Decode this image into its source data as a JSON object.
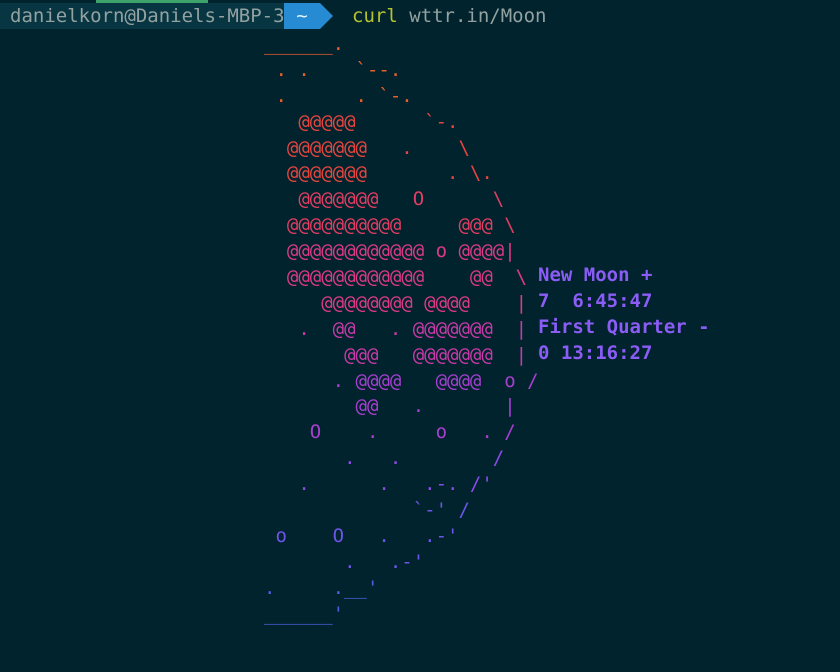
{
  "prompt": {
    "host": "danielkorn@Daniels-MBP-3",
    "dir": "~",
    "command": "curl",
    "argument": "wttr.in/Moon"
  },
  "moon_art": [
    "______.",
    " . .    `--.",
    " .      . `-.",
    "   @@@@@      `-.",
    "  @@@@@@@   .    \\",
    "  @@@@@@@       . \\.",
    "   @@@@@@@   O      \\",
    "  @@@@@@@@@@     @@@ \\",
    "  @@@@@@@@@@@@ o @@@@|",
    "  @@@@@@@@@@@@    @@  \\",
    "     @@@@@@@@ @@@@    |",
    "   .  @@   . @@@@@@@  |",
    "       @@@   @@@@@@@  |",
    "      . @@@@   @@@@  o /",
    "        @@   .       |",
    "    O    .     o   . /",
    "       .   .        /",
    "   .      .   .-. /'",
    "             `-' /",
    " o    O   .   .-'",
    "       .   .-'",
    ".     .__'",
    "______'"
  ],
  "phase": {
    "line1": "New Moon +",
    "line2": "7  6:45:47",
    "line3": "First Quarter -",
    "line4": "0 13:16:27"
  },
  "colors": {
    "background": "#00232d",
    "host_segment": "#073642",
    "dir_segment": "#268bd2",
    "command": "#b5c42d",
    "phase_text": "#8b5cf6",
    "gradient": [
      "#e8602c",
      "#e6453f",
      "#e23d62",
      "#dd3a86",
      "#c93aa8",
      "#a73fd0",
      "#8b4be8",
      "#6c55e8",
      "#4a62df"
    ]
  }
}
